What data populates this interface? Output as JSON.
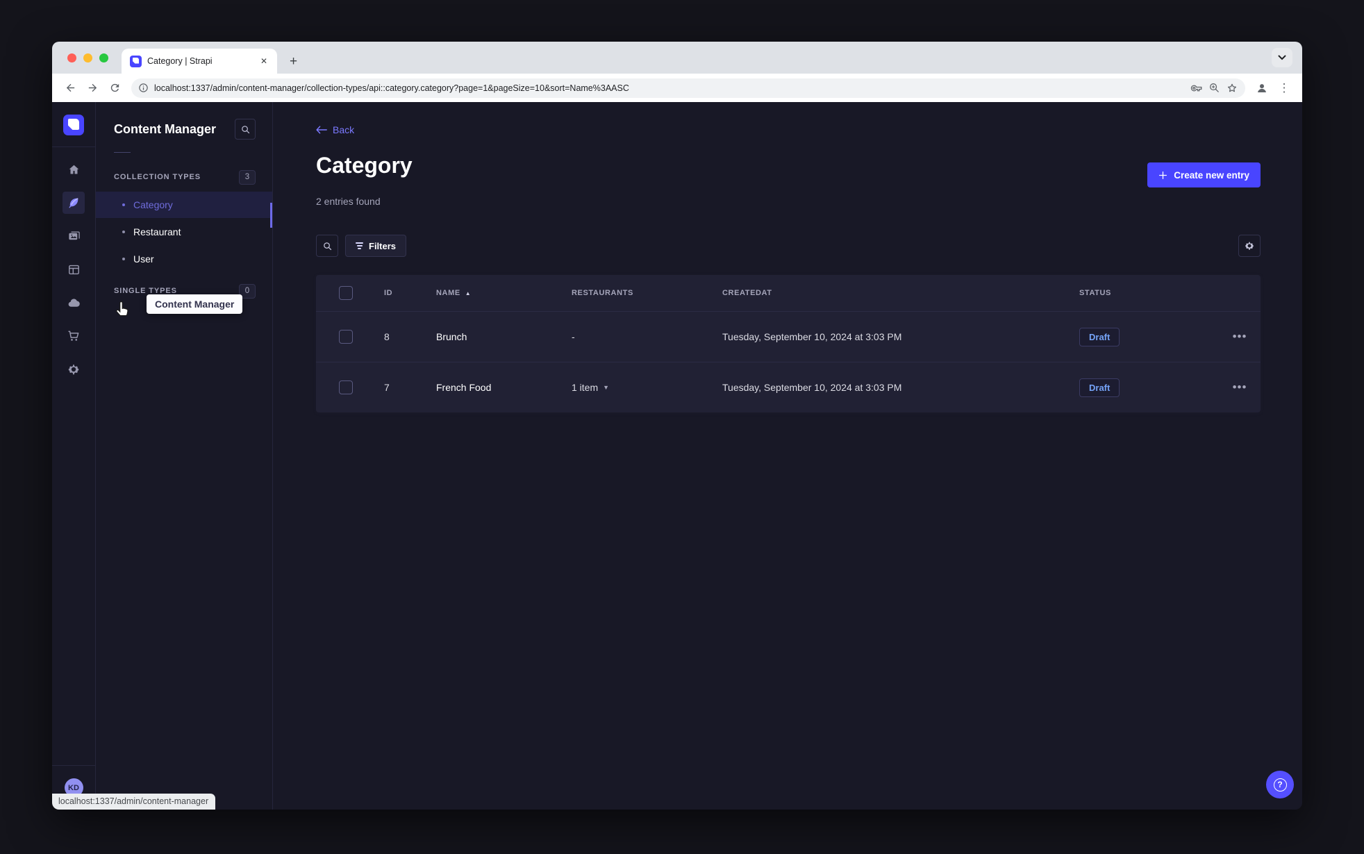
{
  "browser": {
    "tab_title": "Category | Strapi",
    "url": "localhost:1337/admin/content-manager/collection-types/api::category.category?page=1&pageSize=10&sort=Name%3AASC",
    "status_tooltip": "localhost:1337/admin/content-manager"
  },
  "icons": {
    "close": "✕",
    "new_tab": "+",
    "tab_search_chevron": "⌄",
    "kebab": "⋮",
    "sort_asc": "▲",
    "caret_down": "▼",
    "more": "•••",
    "help": "?"
  },
  "sidebar": {
    "title": "Content Manager",
    "tooltip": "Content Manager",
    "user_initials": "KD",
    "sections": [
      {
        "label": "COLLECTION TYPES",
        "count": "3",
        "items": [
          {
            "label": "Category",
            "active": true
          },
          {
            "label": "Restaurant",
            "active": false
          },
          {
            "label": "User",
            "active": false
          }
        ]
      },
      {
        "label": "SINGLE TYPES",
        "count": "0",
        "items": []
      }
    ]
  },
  "main": {
    "back_label": "Back",
    "title": "Category",
    "subtitle": "2 entries found",
    "create_button_label": "Create new entry",
    "filters_button_label": "Filters",
    "table": {
      "headers": [
        "ID",
        "NAME",
        "RESTAURANTS",
        "CREATEDAT",
        "STATUS"
      ],
      "rows": [
        {
          "id": "8",
          "name": "Brunch",
          "restaurants": "-",
          "createdAt": "Tuesday, September 10, 2024 at 3:03 PM",
          "status": "Draft"
        },
        {
          "id": "7",
          "name": "French Food",
          "restaurants": "1 item",
          "createdAt": "Tuesday, September 10, 2024 at 3:03 PM",
          "status": "Draft"
        }
      ]
    }
  },
  "colors": {
    "accent": "#4945ff",
    "accent_light": "#7b79ff",
    "background": "#181826",
    "surface": "#212134",
    "border": "#32324d",
    "text_secondary": "#a5a5ba",
    "status_draft_text": "#75a3f7"
  }
}
